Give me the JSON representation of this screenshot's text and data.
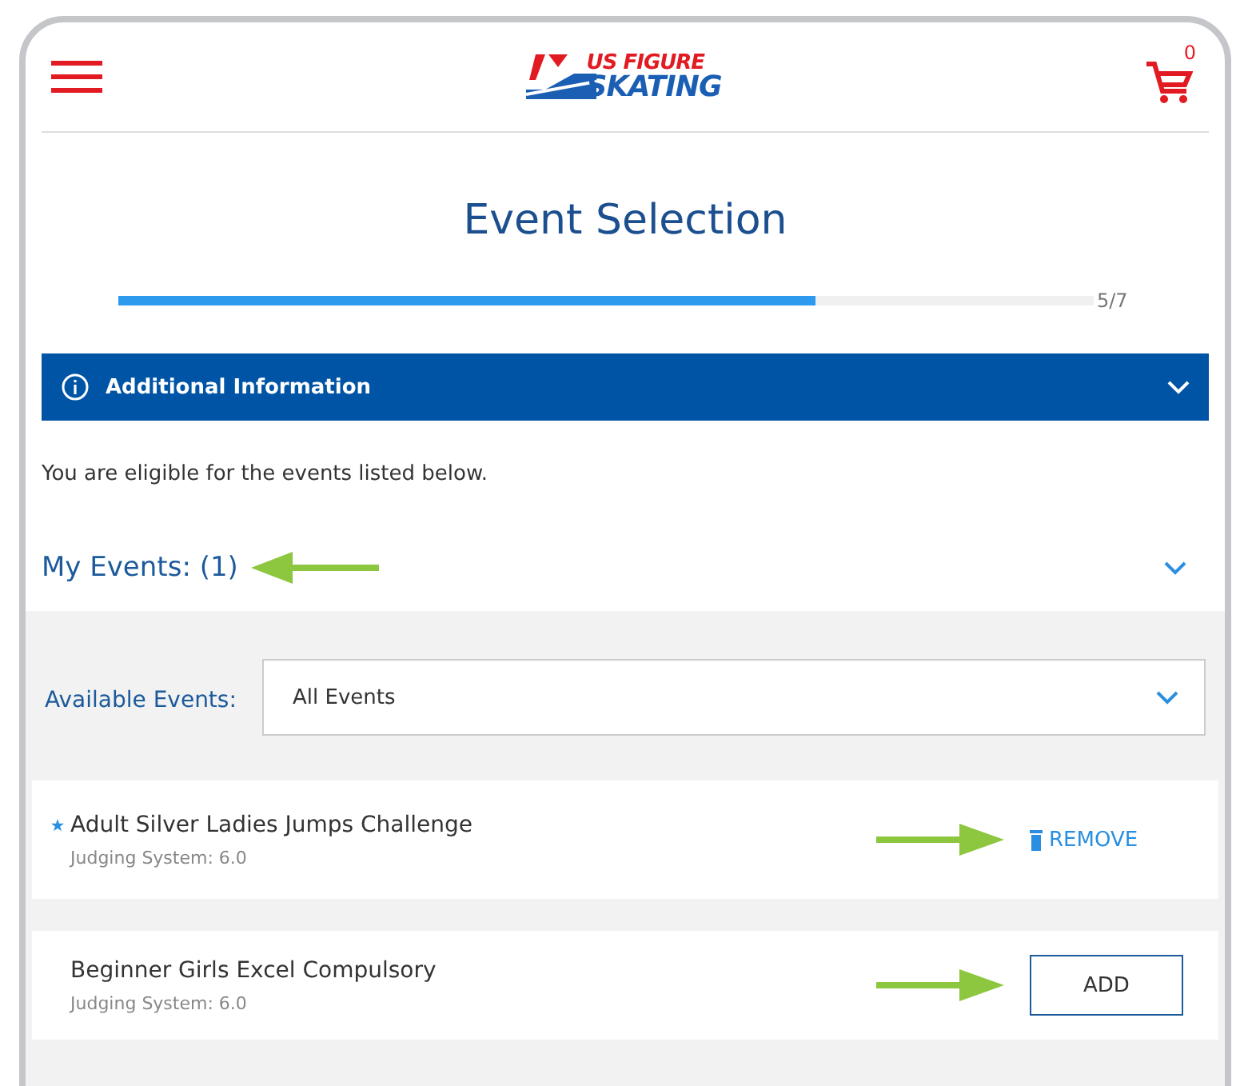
{
  "header": {
    "logo_top": "US FIGURE",
    "logo_bottom": "SKATING",
    "cart_count": "0"
  },
  "title": "Event Selection",
  "progress": {
    "level": 0.714,
    "label": "5/7"
  },
  "info_panel": {
    "label": "Additional Information",
    "expanded": false
  },
  "eligibility_text": "You are eligible for the events listed below.",
  "my_events": {
    "label": "My Events: (1)",
    "expanded": false
  },
  "filter": {
    "label": "Available Events:",
    "value": "All Events"
  },
  "events": [
    {
      "name": "Adult Silver Ladies Jumps Challenge",
      "system": "Judging System: 6.0",
      "added": true,
      "action": "REMOVE"
    },
    {
      "name": "Beginner Girls Excel Compulsory",
      "system": "Judging System: 6.0",
      "added": false,
      "action": "ADD"
    }
  ]
}
